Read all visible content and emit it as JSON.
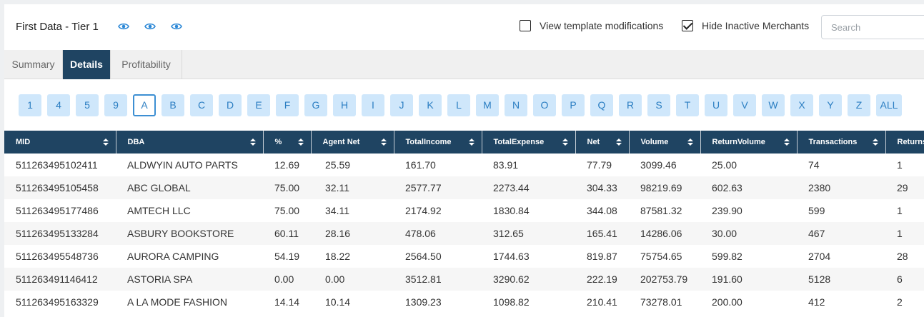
{
  "header": {
    "title": "First Data - Tier 1",
    "icons": [
      "eye-icon",
      "eye-icon",
      "eye-icon"
    ],
    "view_template_label": "View template modifications",
    "view_template_checked": false,
    "hide_inactive_label": "Hide Inactive Merchants",
    "hide_inactive_checked": true,
    "search_placeholder": "Search"
  },
  "tabs": [
    {
      "label": "Summary",
      "active": false
    },
    {
      "label": "Details",
      "active": true
    },
    {
      "label": "Profitability",
      "active": false
    }
  ],
  "letters": [
    "1",
    "4",
    "5",
    "9",
    "A",
    "B",
    "C",
    "D",
    "E",
    "F",
    "G",
    "H",
    "I",
    "J",
    "K",
    "L",
    "M",
    "N",
    "O",
    "P",
    "Q",
    "R",
    "S",
    "T",
    "U",
    "V",
    "W",
    "X",
    "Y",
    "Z",
    "ALL"
  ],
  "active_letter": "A",
  "table": {
    "columns": [
      "MID",
      "DBA",
      "%",
      "Agent Net",
      "TotalIncome",
      "TotalExpense",
      "Net",
      "Volume",
      "ReturnVolume",
      "Transactions",
      "Returns"
    ],
    "rows": [
      [
        "511263495102411",
        "ALDWYIN AUTO PARTS",
        "12.69",
        "25.59",
        "161.70",
        "83.91",
        "77.79",
        "3099.46",
        "25.00",
        "74",
        "1"
      ],
      [
        "511263495105458",
        "ABC GLOBAL",
        "75.00",
        "32.11",
        "2577.77",
        "2273.44",
        "304.33",
        "98219.69",
        "602.63",
        "2380",
        "29"
      ],
      [
        "511263495177486",
        "AMTECH LLC",
        "75.00",
        "34.11",
        "2174.92",
        "1830.84",
        "344.08",
        "87581.32",
        "239.90",
        "599",
        "1"
      ],
      [
        "511263495133284",
        "ASBURY BOOKSTORE",
        "60.11",
        "28.16",
        "478.06",
        "312.65",
        "165.41",
        "14286.06",
        "30.00",
        "467",
        "1"
      ],
      [
        "511263495548736",
        "AURORA CAMPING",
        "54.19",
        "18.22",
        "2564.50",
        "1744.63",
        "819.87",
        "75754.65",
        "599.82",
        "2704",
        "28"
      ],
      [
        "511263491146412",
        "ASTORIA SPA",
        "0.00",
        "0.00",
        "3512.81",
        "3290.62",
        "222.19",
        "202753.79",
        "191.60",
        "5128",
        "6"
      ],
      [
        "511263495163329",
        "A LA MODE FASHION",
        "14.14",
        "10.14",
        "1309.23",
        "1098.82",
        "210.41",
        "73278.01",
        "200.00",
        "412",
        "2"
      ]
    ]
  },
  "colors": {
    "header_bg": "#1f4462",
    "letter_bg": "#cfe7fb",
    "letter_text": "#2b7ec2",
    "eye_icon": "#2b87d6"
  }
}
